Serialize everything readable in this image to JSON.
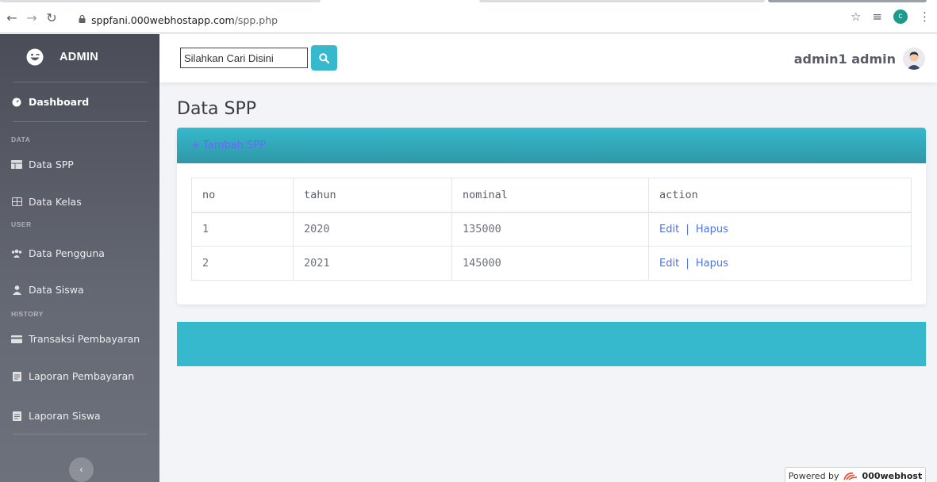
{
  "browser": {
    "url_host": "sppfani.000webhostapp.com",
    "url_path": "/spp.php",
    "profile_initial": "c"
  },
  "sidebar": {
    "brand": "ADMIN",
    "dashboard": "Dashboard",
    "headings": {
      "data": "DATA",
      "user": "USER",
      "history": "HISTORY"
    },
    "items": {
      "data_spp": "Data SPP",
      "data_kelas": "Data Kelas",
      "data_pengguna": "Data Pengguna",
      "data_siswa": "Data Siswa",
      "transaksi": "Transaksi Pembayaran",
      "laporan_pembayaran": "Laporan Pembayaran",
      "laporan_siswa": "Laporan Siswa"
    },
    "toggle": "‹"
  },
  "topbar": {
    "search_placeholder": "Silahkan Cari Disini",
    "user_name": "admin1 admin"
  },
  "main": {
    "title": "Data SPP",
    "add_link": "+ Tambah SPP",
    "table": {
      "headers": {
        "no": "no",
        "tahun": "tahun",
        "nominal": "nominal",
        "action": "action"
      },
      "rows": [
        {
          "no": "1",
          "tahun": "2020",
          "nominal": "135000",
          "edit": "Edit",
          "sep": "|",
          "hapus": "Hapus"
        },
        {
          "no": "2",
          "tahun": "2021",
          "nominal": "145000",
          "edit": "Edit",
          "sep": "|",
          "hapus": "Hapus"
        }
      ]
    }
  },
  "powered": {
    "prefix": "Powered by",
    "brand": "000webhost"
  },
  "colors": {
    "accent": "#36b9cc",
    "link": "#4e73df",
    "sidebar": "#5a5d68"
  }
}
